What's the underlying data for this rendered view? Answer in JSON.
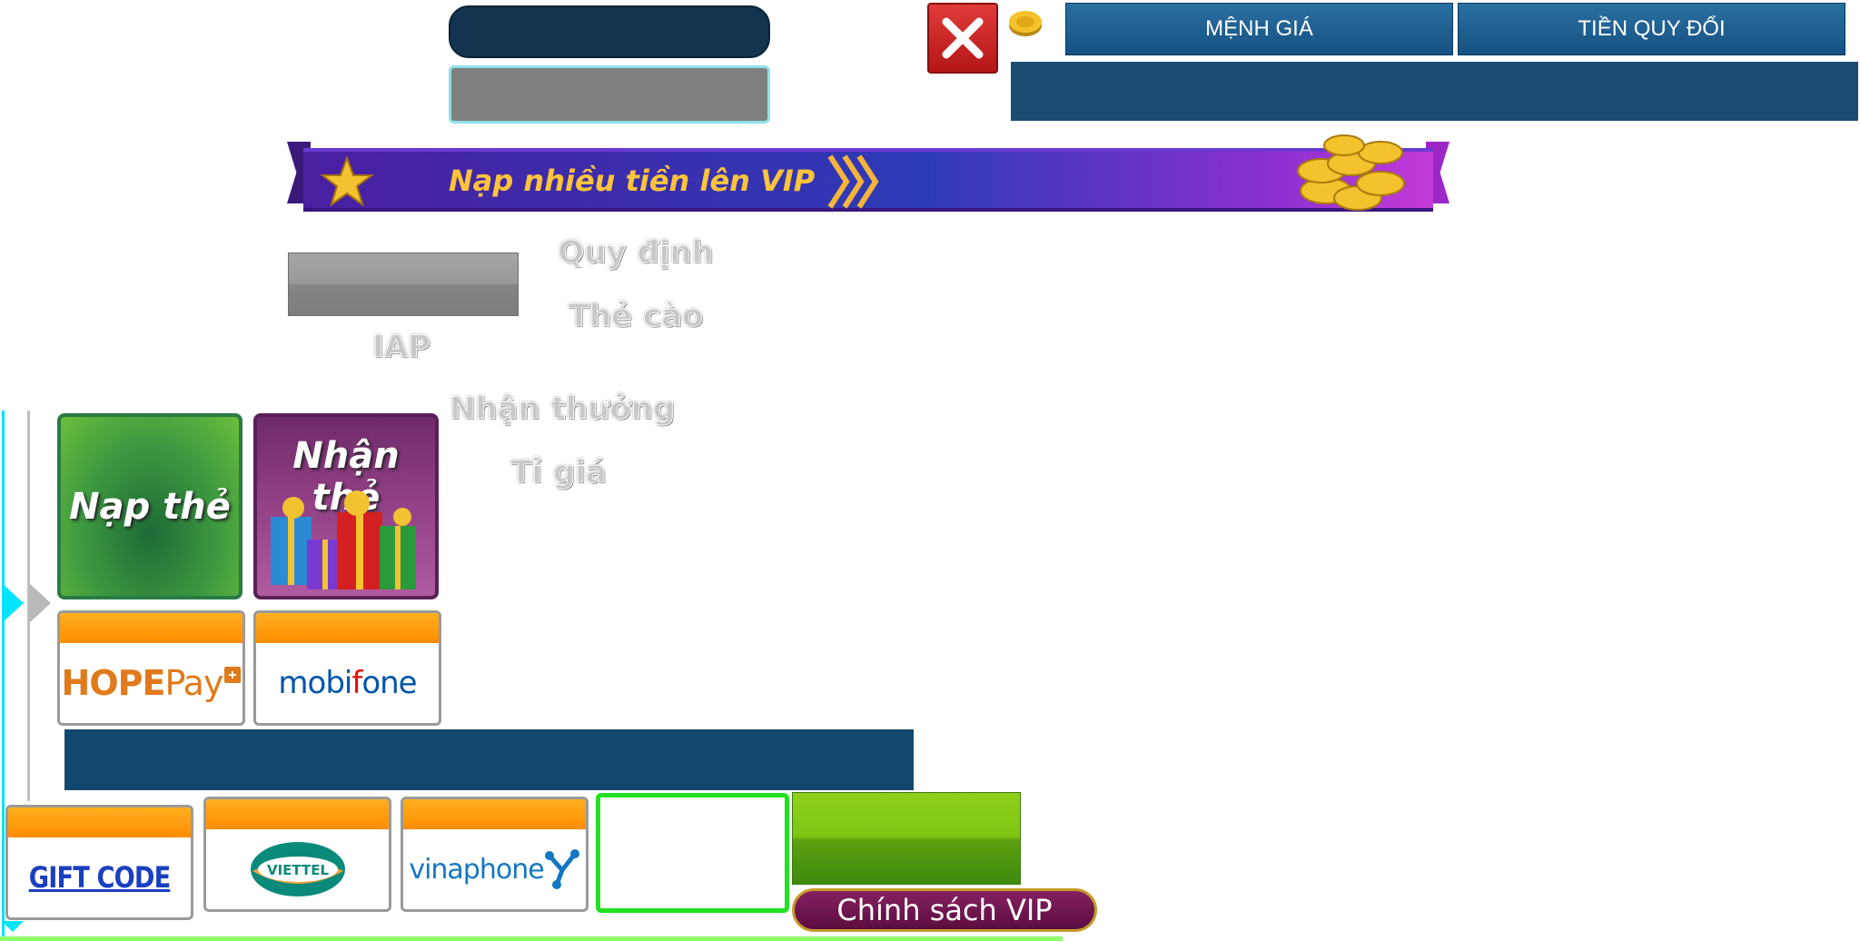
{
  "header": {
    "tab_menh_gia": "MỆNH GIÁ",
    "tab_tien_quy_doi": "TIỀN QUY ĐỔI"
  },
  "banner": {
    "text": "Nạp nhiều tiền lên VIP"
  },
  "menu": {
    "iap": "IAP",
    "quy_dinh": "Quy định",
    "the_cao": "Thẻ cào",
    "nhan_thuong": "Nhận thưởng",
    "ti_gia": "Tỉ giá"
  },
  "tiles": {
    "nap_the": "Nạp thẻ",
    "nhan_the": "Nhận thẻ"
  },
  "providers": {
    "hope_main": "HOPE",
    "hope_pay": "Pay",
    "mobi_main": "mobi",
    "mobi_f": "f",
    "mobi_one": "one",
    "gift_code": "GIFT CODE",
    "viettel": "VIETTEL",
    "vina": "vinaphone"
  },
  "vip_policy": "Chính sách VIP",
  "colors": {
    "accent_cyan": "#00e5ff",
    "banner_purple": "#4a1fa0",
    "close_red": "#d42020",
    "tab_blue": "#1b5f92",
    "green_outline": "#22e022"
  }
}
